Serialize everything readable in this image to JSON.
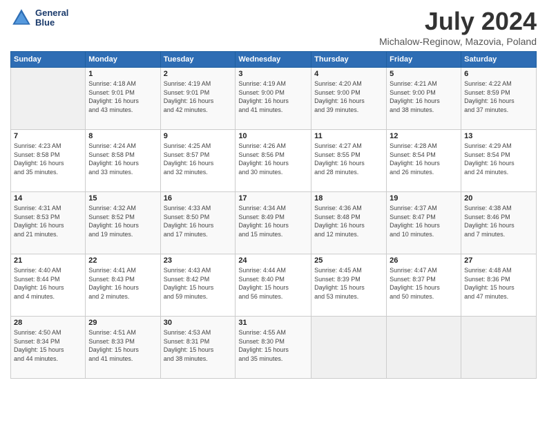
{
  "logo": {
    "line1": "General",
    "line2": "Blue"
  },
  "title": "July 2024",
  "subtitle": "Michalow-Reginow, Mazovia, Poland",
  "days_of_week": [
    "Sunday",
    "Monday",
    "Tuesday",
    "Wednesday",
    "Thursday",
    "Friday",
    "Saturday"
  ],
  "weeks": [
    [
      {
        "day": "",
        "info": ""
      },
      {
        "day": "1",
        "info": "Sunrise: 4:18 AM\nSunset: 9:01 PM\nDaylight: 16 hours\nand 43 minutes."
      },
      {
        "day": "2",
        "info": "Sunrise: 4:19 AM\nSunset: 9:01 PM\nDaylight: 16 hours\nand 42 minutes."
      },
      {
        "day": "3",
        "info": "Sunrise: 4:19 AM\nSunset: 9:00 PM\nDaylight: 16 hours\nand 41 minutes."
      },
      {
        "day": "4",
        "info": "Sunrise: 4:20 AM\nSunset: 9:00 PM\nDaylight: 16 hours\nand 39 minutes."
      },
      {
        "day": "5",
        "info": "Sunrise: 4:21 AM\nSunset: 9:00 PM\nDaylight: 16 hours\nand 38 minutes."
      },
      {
        "day": "6",
        "info": "Sunrise: 4:22 AM\nSunset: 8:59 PM\nDaylight: 16 hours\nand 37 minutes."
      }
    ],
    [
      {
        "day": "7",
        "info": "Sunrise: 4:23 AM\nSunset: 8:58 PM\nDaylight: 16 hours\nand 35 minutes."
      },
      {
        "day": "8",
        "info": "Sunrise: 4:24 AM\nSunset: 8:58 PM\nDaylight: 16 hours\nand 33 minutes."
      },
      {
        "day": "9",
        "info": "Sunrise: 4:25 AM\nSunset: 8:57 PM\nDaylight: 16 hours\nand 32 minutes."
      },
      {
        "day": "10",
        "info": "Sunrise: 4:26 AM\nSunset: 8:56 PM\nDaylight: 16 hours\nand 30 minutes."
      },
      {
        "day": "11",
        "info": "Sunrise: 4:27 AM\nSunset: 8:55 PM\nDaylight: 16 hours\nand 28 minutes."
      },
      {
        "day": "12",
        "info": "Sunrise: 4:28 AM\nSunset: 8:54 PM\nDaylight: 16 hours\nand 26 minutes."
      },
      {
        "day": "13",
        "info": "Sunrise: 4:29 AM\nSunset: 8:54 PM\nDaylight: 16 hours\nand 24 minutes."
      }
    ],
    [
      {
        "day": "14",
        "info": "Sunrise: 4:31 AM\nSunset: 8:53 PM\nDaylight: 16 hours\nand 21 minutes."
      },
      {
        "day": "15",
        "info": "Sunrise: 4:32 AM\nSunset: 8:52 PM\nDaylight: 16 hours\nand 19 minutes."
      },
      {
        "day": "16",
        "info": "Sunrise: 4:33 AM\nSunset: 8:50 PM\nDaylight: 16 hours\nand 17 minutes."
      },
      {
        "day": "17",
        "info": "Sunrise: 4:34 AM\nSunset: 8:49 PM\nDaylight: 16 hours\nand 15 minutes."
      },
      {
        "day": "18",
        "info": "Sunrise: 4:36 AM\nSunset: 8:48 PM\nDaylight: 16 hours\nand 12 minutes."
      },
      {
        "day": "19",
        "info": "Sunrise: 4:37 AM\nSunset: 8:47 PM\nDaylight: 16 hours\nand 10 minutes."
      },
      {
        "day": "20",
        "info": "Sunrise: 4:38 AM\nSunset: 8:46 PM\nDaylight: 16 hours\nand 7 minutes."
      }
    ],
    [
      {
        "day": "21",
        "info": "Sunrise: 4:40 AM\nSunset: 8:44 PM\nDaylight: 16 hours\nand 4 minutes."
      },
      {
        "day": "22",
        "info": "Sunrise: 4:41 AM\nSunset: 8:43 PM\nDaylight: 16 hours\nand 2 minutes."
      },
      {
        "day": "23",
        "info": "Sunrise: 4:43 AM\nSunset: 8:42 PM\nDaylight: 15 hours\nand 59 minutes."
      },
      {
        "day": "24",
        "info": "Sunrise: 4:44 AM\nSunset: 8:40 PM\nDaylight: 15 hours\nand 56 minutes."
      },
      {
        "day": "25",
        "info": "Sunrise: 4:45 AM\nSunset: 8:39 PM\nDaylight: 15 hours\nand 53 minutes."
      },
      {
        "day": "26",
        "info": "Sunrise: 4:47 AM\nSunset: 8:37 PM\nDaylight: 15 hours\nand 50 minutes."
      },
      {
        "day": "27",
        "info": "Sunrise: 4:48 AM\nSunset: 8:36 PM\nDaylight: 15 hours\nand 47 minutes."
      }
    ],
    [
      {
        "day": "28",
        "info": "Sunrise: 4:50 AM\nSunset: 8:34 PM\nDaylight: 15 hours\nand 44 minutes."
      },
      {
        "day": "29",
        "info": "Sunrise: 4:51 AM\nSunset: 8:33 PM\nDaylight: 15 hours\nand 41 minutes."
      },
      {
        "day": "30",
        "info": "Sunrise: 4:53 AM\nSunset: 8:31 PM\nDaylight: 15 hours\nand 38 minutes."
      },
      {
        "day": "31",
        "info": "Sunrise: 4:55 AM\nSunset: 8:30 PM\nDaylight: 15 hours\nand 35 minutes."
      },
      {
        "day": "",
        "info": ""
      },
      {
        "day": "",
        "info": ""
      },
      {
        "day": "",
        "info": ""
      }
    ]
  ]
}
